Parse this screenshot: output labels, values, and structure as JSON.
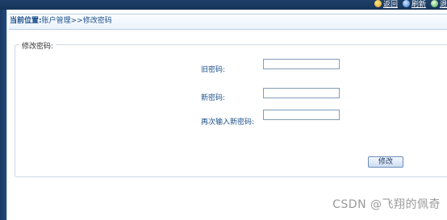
{
  "topbar": {
    "links": [
      {
        "label": "返回",
        "icon": "home-icon"
      },
      {
        "label": "刷新",
        "icon": "refresh-icon"
      },
      {
        "label": "退",
        "icon": "exit-icon"
      }
    ]
  },
  "breadcrumb": {
    "prefix": "当前位置:",
    "path": "账户管理>>修改密码"
  },
  "form": {
    "legend": "修改密码:",
    "old_password_label": "旧密码:",
    "old_password_value": "",
    "new_password_label": "新密码:",
    "new_password_value": "",
    "confirm_password_label": "再次输入新密码:",
    "confirm_password_value": "",
    "submit_label": "修改"
  },
  "watermark": "CSDN @飞翔的佩奇"
}
